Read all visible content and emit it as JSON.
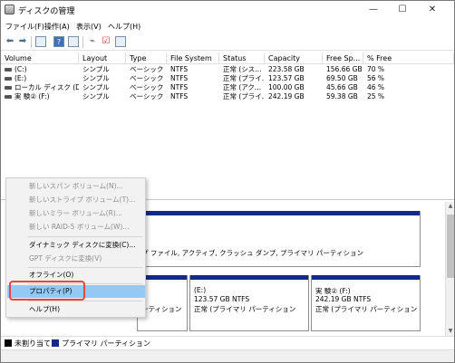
{
  "window": {
    "title": "ディスクの管理",
    "minimize": "—",
    "maximize": "☐",
    "close": "✕"
  },
  "menu": [
    "ファイル(F)",
    "操作(A)",
    "表示(V)",
    "ヘルプ(H)"
  ],
  "table": {
    "headers": [
      "Volume",
      "Layout",
      "Type",
      "File System",
      "Status",
      "Capacity",
      "Free Sp...",
      "% Free"
    ],
    "rows": [
      [
        "(C:)",
        "シンプル",
        "ベーシック",
        "NTFS",
        "正常 (シス...",
        "223.58 GB",
        "156.66 GB",
        "70 %"
      ],
      [
        "(E:)",
        "シンプル",
        "ベーシック",
        "NTFS",
        "正常 (プライ...",
        "123.57 GB",
        "69.50 GB",
        "56 %"
      ],
      [
        "ローカル ディスク (D:)",
        "シンプル",
        "ベーシック",
        "NTFS",
        "正常 (アク...",
        "100.00 GB",
        "45.66 GB",
        "46 %"
      ],
      [
        "実 験② (F:)",
        "シンプル",
        "ベーシック",
        "NTFS",
        "正常 (プライ...",
        "242.19 GB",
        "59.38 GB",
        "25 %"
      ]
    ]
  },
  "graph": {
    "disk0_text": "プ ファイル, アクティブ, クラッシュ ダンプ, プライマリ パーティション",
    "disk1_left_text": "ーティション",
    "partition_e": {
      "name": "(E:)",
      "size": "123.57 GB NTFS",
      "status": "正常 (プライマリ パーティション"
    },
    "partition_f": {
      "name": "実 験② (F:)",
      "size": "242.19 GB NTFS",
      "status": "正常 (プライマリ パーティション"
    }
  },
  "legend": {
    "unallocated": "未割り当て",
    "primary": "プライマリ パーティション",
    "unallocated_color": "#000000",
    "primary_color": "#132a8c"
  },
  "context_menu": {
    "new_spanned": "新しいスパン ボリューム(N)...",
    "new_striped": "新しいストライプ ボリューム(T)...",
    "new_mirror": "新しいミラー ボリューム(R)...",
    "new_raid5": "新しい RAID-5 ボリューム(W)...",
    "convert_dynamic": "ダイナミック ディスクに変換(C)...",
    "convert_gpt": "GPT ディスクに変換(V)",
    "offline": "オフライン(O)",
    "properties": "プロパティ(P)",
    "help": "ヘルプ(H)"
  }
}
